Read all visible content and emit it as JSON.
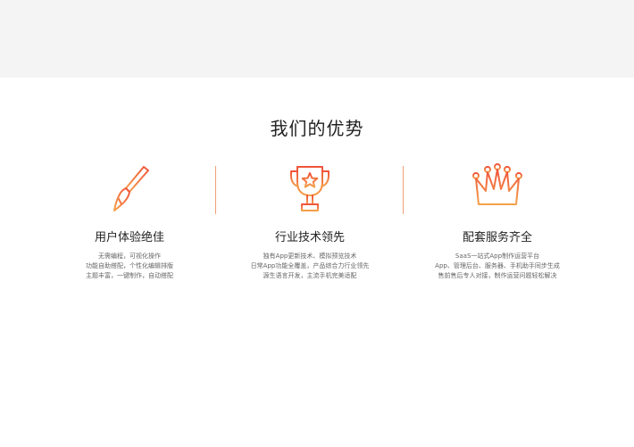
{
  "section": {
    "title": "我们的优势"
  },
  "features": [
    {
      "icon": "brush-icon",
      "title": "用户体验绝佳",
      "lines": [
        "无需编程，可视化操作",
        "功能自助搭配，个性化编辑排版",
        "主题丰富，一键制作，自动搭配"
      ]
    },
    {
      "icon": "trophy-icon",
      "title": "行业技术领先",
      "lines": [
        "独有App更新技术、模拟预览技术",
        "日常App功能全覆盖，产品综合力行业领先",
        "源生语言开发，主流手机完美适配"
      ]
    },
    {
      "icon": "crown-icon",
      "title": "配套服务齐全",
      "lines": [
        "SaaS一站式App制作运营平台",
        "App、管理后台、服务器、手机助手同步生成",
        "售前售后专人对接，制作运营问题轻松解决"
      ]
    }
  ],
  "colors": {
    "accent_start": "#f0533a",
    "accent_end": "#f5a14a",
    "divider": "#f0a07a",
    "top_band": "#f4f4f4"
  }
}
